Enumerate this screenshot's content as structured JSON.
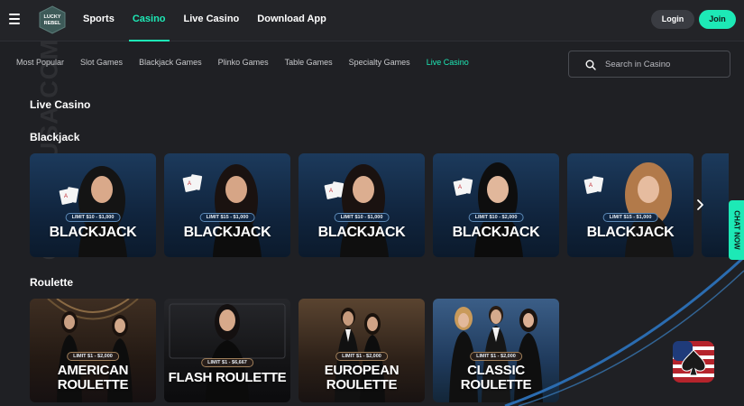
{
  "header": {
    "logo_text": "LUCKY REBEL",
    "nav": [
      {
        "label": "Sports"
      },
      {
        "label": "Casino",
        "active": true
      },
      {
        "label": "Live Casino"
      },
      {
        "label": "Download App"
      }
    ],
    "login_label": "Login",
    "join_label": "Join"
  },
  "watermark": "CASINOUSA.COM",
  "categories": [
    {
      "label": "Most Popular"
    },
    {
      "label": "Slot Games"
    },
    {
      "label": "Blackjack Games"
    },
    {
      "label": "Plinko Games"
    },
    {
      "label": "Table Games"
    },
    {
      "label": "Specialty Games"
    },
    {
      "label": "Live Casino",
      "active": true
    }
  ],
  "search": {
    "placeholder": "Search in Casino"
  },
  "page_title": "Live Casino",
  "blackjack": {
    "heading": "Blackjack",
    "games": [
      {
        "name": "BLACKJACK",
        "limit": "LIMIT $10 - $1,000"
      },
      {
        "name": "BLACKJACK",
        "limit": "LIMIT $15 - $1,000"
      },
      {
        "name": "BLACKJACK",
        "limit": "LIMIT $10 - $1,000"
      },
      {
        "name": "BLACKJACK",
        "limit": "LIMIT $10 - $2,000"
      },
      {
        "name": "BLACKJACK",
        "limit": "LIMIT $15 - $1,000"
      }
    ]
  },
  "roulette": {
    "heading": "Roulette",
    "games": [
      {
        "line1": "AMERICAN",
        "line2": "ROULETTE",
        "limit": "LIMIT $1 - $2,000"
      },
      {
        "line1": "FLASH ROULETTE",
        "line2": "",
        "limit": "LIMIT $1 - $6,667"
      },
      {
        "line1": "EUROPEAN",
        "line2": "ROULETTE",
        "limit": "LIMIT $1 - $2,000"
      },
      {
        "line1": "CLASSIC",
        "line2": "ROULETTE",
        "limit": "LIMIT $1 - $2,000"
      }
    ]
  },
  "chat_label": "CHAT NOW",
  "colors": {
    "accent": "#1de9b6",
    "background": "#1f2024"
  }
}
